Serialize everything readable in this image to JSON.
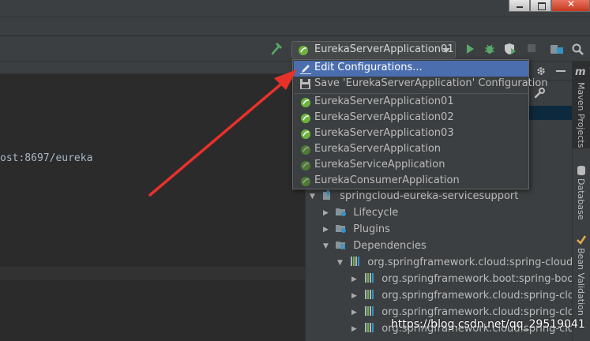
{
  "toolbar": {
    "run_config": "EurekaServerApplication01"
  },
  "dropdown": {
    "actions": [
      {
        "label": "Edit Configurations...",
        "icon": "pencil-icon"
      },
      {
        "label": "Save 'EurekaServerApplication' Configuration",
        "icon": "save-icon"
      }
    ],
    "configs": [
      {
        "label": "EurekaServerApplication01",
        "icon": "spring-boot-icon"
      },
      {
        "label": "EurekaServerApplication02",
        "icon": "spring-boot-icon"
      },
      {
        "label": "EurekaServerApplication03",
        "icon": "spring-boot-icon"
      },
      {
        "label": "EurekaServerApplication",
        "icon": "spring-boot-icon-dimmed"
      },
      {
        "label": "EurekaServiceApplication",
        "icon": "spring-boot-icon-dimmed"
      },
      {
        "label": "EurekaConsumerApplication",
        "icon": "spring-boot-icon-dimmed"
      }
    ]
  },
  "editor": {
    "code_fragment": "ost:8697/eureka"
  },
  "maven": {
    "tree": [
      {
        "label": "springcloud-eureka-servicesupport",
        "icon": "maven-module-icon"
      },
      {
        "label": "Lifecycle",
        "icon": "folder-gear-icon"
      },
      {
        "label": "Plugins",
        "icon": "folder-gear-icon"
      },
      {
        "label": "Dependencies",
        "icon": "folder-library-icon"
      },
      {
        "label": "org.springframework.cloud:spring-cloud-star",
        "icon": "library-icon"
      },
      {
        "label": "org.springframework.boot:spring-boot-sta",
        "icon": "library-icon"
      },
      {
        "label": "org.springframework.cloud:spring-cloud-s",
        "icon": "library-icon"
      },
      {
        "label": "org.springframework.cloud:spring-cloud-n",
        "icon": "library-icon"
      },
      {
        "label": "org.springframework.cloud:spring-cloud-",
        "icon": "library-icon"
      }
    ]
  },
  "stripe": {
    "maven_projects": "Maven Projects",
    "database": "Database",
    "bean_validation": "Bean Validation"
  },
  "watermark": "https://blog.csdn.net/qq_29519041",
  "colors": {
    "selection": "#4b6eaf",
    "arrow": "#e8312a",
    "spring_green": "#6db33f"
  }
}
